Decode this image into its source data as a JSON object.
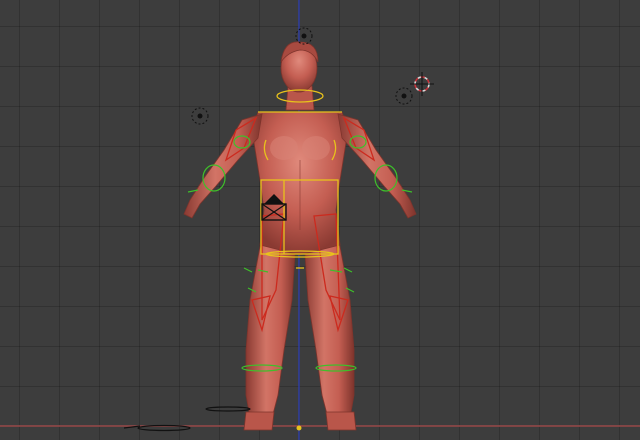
{
  "viewport": {
    "background_color": "#3d3d3d",
    "grid_line_color": "#333333",
    "vertical_axis_color": "#2f3fa8",
    "horizontal_axis_color": "#9a4a4a"
  },
  "model": {
    "skin_color": "#c45e52",
    "skin_highlight": "#e08a7c",
    "skin_shadow": "#8a3a32"
  },
  "rig": {
    "bone_outline_color": "#cc2a1e",
    "control_circle_color": "#3fbf2a",
    "selected_color": "#e8c21c"
  },
  "scene_objects": {
    "lamp_icon": "lamp-icon",
    "camera_icon": "camera-icon",
    "cursor_icon": "3d-cursor-icon",
    "empty_icon": "empty-object-icon"
  }
}
